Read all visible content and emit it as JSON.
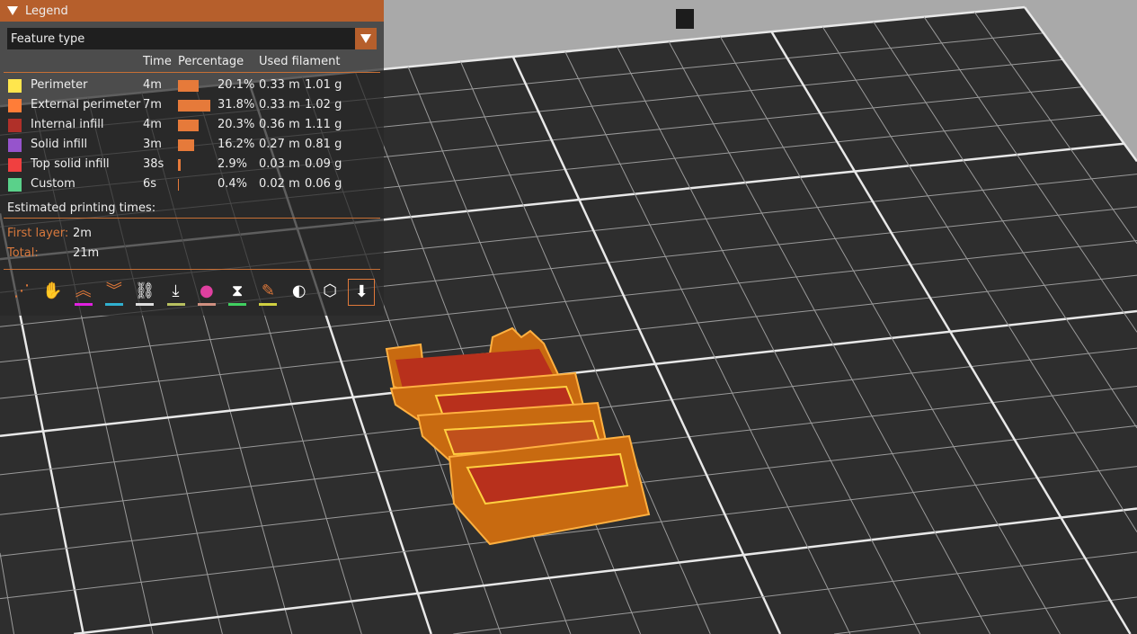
{
  "legend": {
    "title": "Legend",
    "view_type": "Feature type",
    "headers": {
      "time": "Time",
      "percentage": "Percentage",
      "used_filament": "Used filament"
    },
    "rows": [
      {
        "label": "Perimeter",
        "color": "#ffe64d",
        "time": "4m",
        "pct": 20.1,
        "pct_text": "20.1%",
        "length": "0.33 m",
        "weight": "1.01 g"
      },
      {
        "label": "External perimeter",
        "color": "#ff7d38",
        "time": "7m",
        "pct": 31.8,
        "pct_text": "31.8%",
        "length": "0.33 m",
        "weight": "1.02 g"
      },
      {
        "label": "Internal infill",
        "color": "#b03029",
        "time": "4m",
        "pct": 20.3,
        "pct_text": "20.3%",
        "length": "0.36 m",
        "weight": "1.11 g"
      },
      {
        "label": "Solid infill",
        "color": "#9654cc",
        "time": "3m",
        "pct": 16.2,
        "pct_text": "16.2%",
        "length": "0.27 m",
        "weight": "0.81 g"
      },
      {
        "label": "Top solid infill",
        "color": "#f04040",
        "time": "38s",
        "pct": 2.9,
        "pct_text": "2.9%",
        "length": "0.03 m",
        "weight": "0.09 g"
      },
      {
        "label": "Custom",
        "color": "#5ad18a",
        "time": "6s",
        "pct": 0.4,
        "pct_text": "0.4%",
        "length": "0.02 m",
        "weight": "0.06 g"
      }
    ],
    "estimated_title": "Estimated printing times:",
    "first_layer_label": "First layer:",
    "first_layer": "2m",
    "total_label": "Total:",
    "total": "21m",
    "toolbar": [
      {
        "name": "travel",
        "underline": null
      },
      {
        "name": "wipe",
        "underline": null
      },
      {
        "name": "retractions",
        "underline": "#e020e0"
      },
      {
        "name": "deretractions",
        "underline": "#30b0d0"
      },
      {
        "name": "seams",
        "underline": "#dddddd"
      },
      {
        "name": "tool-changes",
        "underline": "#b8c060"
      },
      {
        "name": "color-changes",
        "underline": "#d09080"
      },
      {
        "name": "pause-prints",
        "underline": "#40d060"
      },
      {
        "name": "custom-gcodes",
        "underline": "#d0d040"
      },
      {
        "name": "center-of-gravity",
        "underline": null
      },
      {
        "name": "shells",
        "underline": null
      },
      {
        "name": "tool-marker",
        "underline": null
      }
    ]
  }
}
